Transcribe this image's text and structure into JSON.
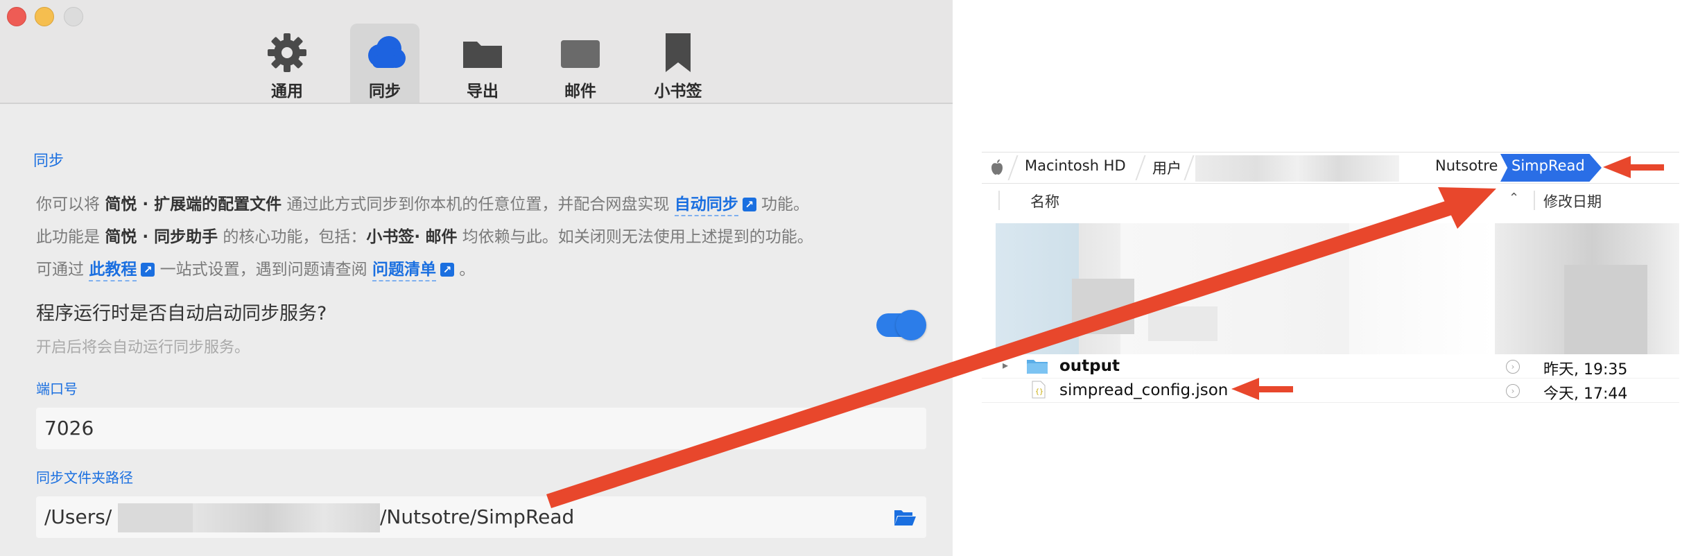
{
  "prefs": {
    "toolbar": [
      {
        "label": "通用",
        "icon": "gear-icon"
      },
      {
        "label": "同步",
        "icon": "cloud-icon",
        "active": true
      },
      {
        "label": "导出",
        "icon": "folder-icon"
      },
      {
        "label": "邮件",
        "icon": "mail-icon"
      },
      {
        "label": "小书签",
        "icon": "bookmark-icon"
      }
    ],
    "section_title": "同步",
    "desc": {
      "l1_a": "你可以将",
      "l1_b": "简悦 · 扩展端的配置文件",
      "l1_c": "通过此方式同步到你本机的任意位置，并配合网盘实现",
      "l1_link": "自动同步",
      "l1_d": "功能。",
      "l2_a": "此功能是",
      "l2_b": "简悦 · 同步助手",
      "l2_c": "的核心功能，包括：",
      "l2_d": "小书签",
      "l2_e": "·",
      "l2_f": "邮件",
      "l2_g": "均依赖与此。如关闭则无法使用上述提到的功能。",
      "l3_a": "可通过",
      "l3_link1": "此教程",
      "l3_b": "一站式设置，遇到问题请查阅",
      "l3_link2": "问题清单",
      "l3_c": "。"
    },
    "autostart_question": "程序运行时是否自动启动同步服务?",
    "autostart_hint": "开启后将会自动运行同步服务。",
    "autostart_on": true,
    "port_label": "端口号",
    "port_value": "7026",
    "path_label": "同步文件夹路径",
    "path_prefix": "/Users/",
    "path_suffix": "/Nutsotre/SimpRead",
    "accent": "#1a6fe0"
  },
  "finder": {
    "breadcrumb": [
      "Macintosh HD",
      "用户",
      "Nutsotre",
      "SimpRead"
    ],
    "columns": {
      "name": "名称",
      "date": "修改日期"
    },
    "rows": [
      {
        "name": "output",
        "date": "昨天, 19:35",
        "kind": "folder"
      },
      {
        "name": "simpread_config.json",
        "date": "今天, 17:44",
        "kind": "json"
      }
    ]
  },
  "annotation_color": "#e8472c"
}
